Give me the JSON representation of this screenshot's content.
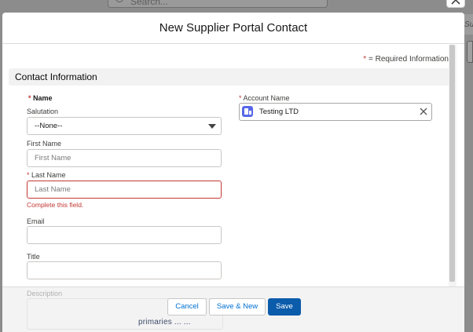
{
  "background": {
    "search_placeholder": "Search...",
    "right_tab_text": "Su",
    "bottom_link_text": "primaries ... ..."
  },
  "modal": {
    "title": "New Supplier Portal Contact",
    "required_info": "= Required Information",
    "required_marker": "*",
    "section_title": "Contact Information",
    "fields": {
      "name_label": "Name",
      "salutation_label": "Salutation",
      "salutation_value": "--None--",
      "first_name_label": "First Name",
      "first_name_placeholder": "First Name",
      "last_name_label": "Last Name",
      "last_name_placeholder": "Last Name",
      "last_name_error": "Complete this field.",
      "email_label": "Email",
      "title_label": "Title",
      "description_label": "Description",
      "account_name_label": "Account Name",
      "account_name_value": "Testing LTD"
    },
    "buttons": {
      "cancel": "Cancel",
      "save_new": "Save & New",
      "save": "Save"
    }
  },
  "colors": {
    "brand_button": "#0b5cab",
    "error": "#c23934",
    "account_icon": "#5867e8"
  },
  "icons": [
    "search-icon",
    "close-icon",
    "chevron-down-icon",
    "account-icon",
    "remove-icon"
  ]
}
